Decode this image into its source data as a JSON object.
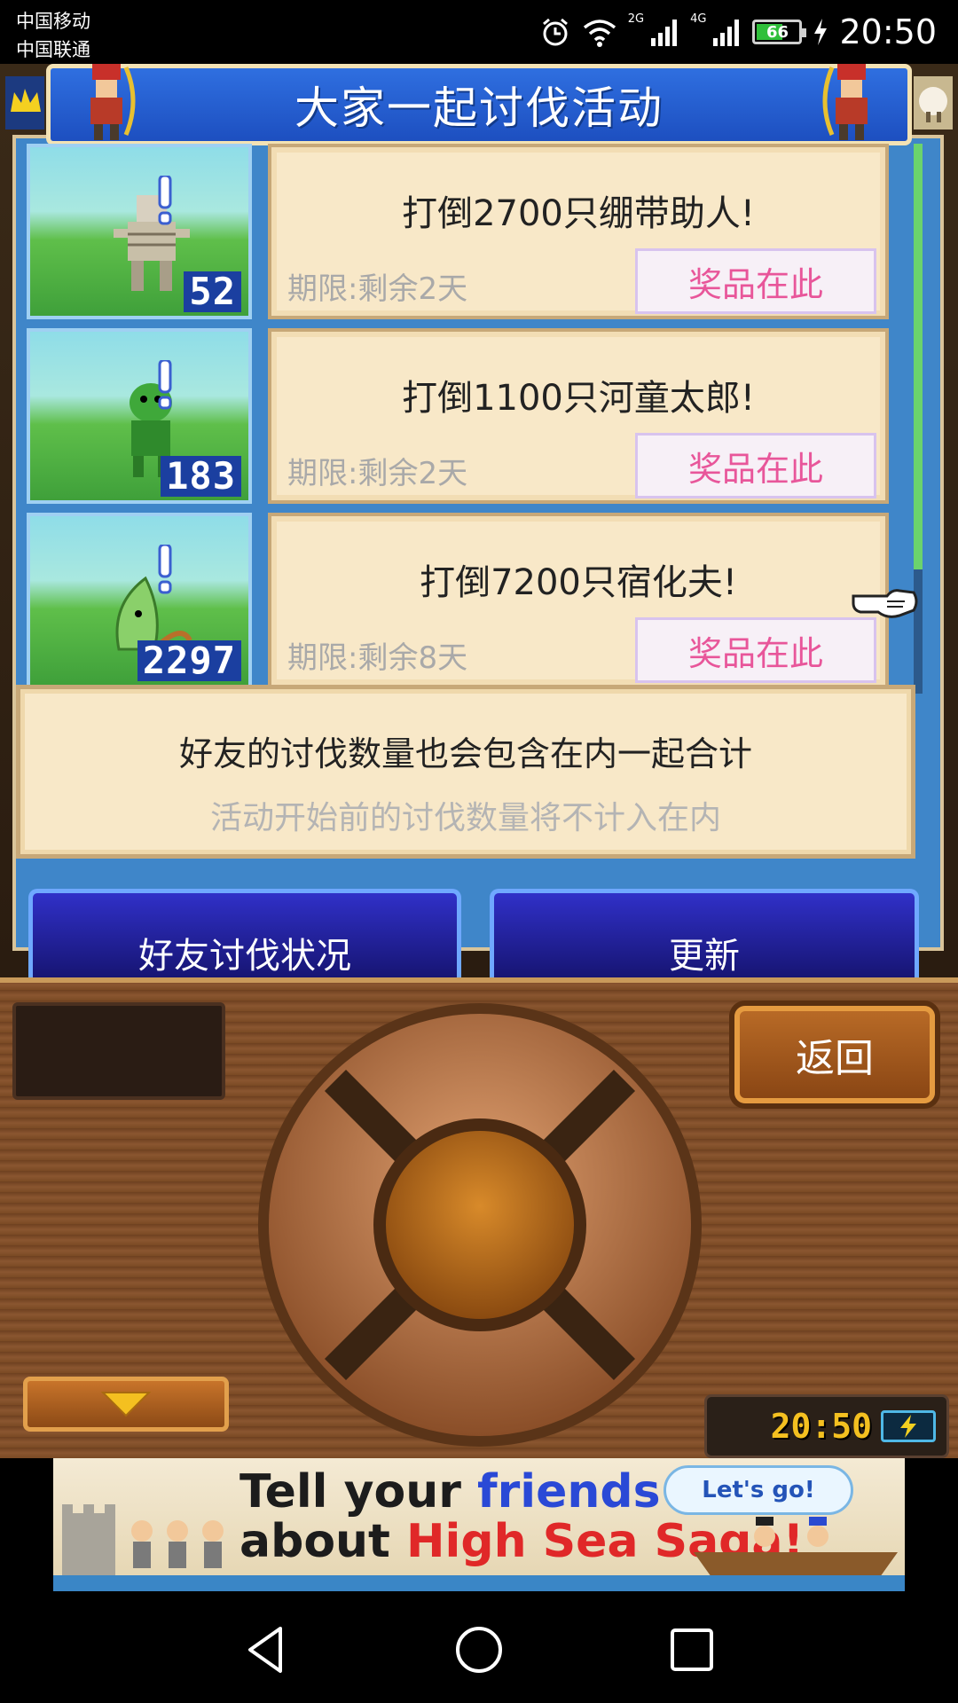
{
  "status_bar": {
    "carrier_1": "中国移动",
    "carrier_2": "中国联通",
    "net_1": "2G",
    "net_2": "4G",
    "battery_level": "66",
    "battery_fraction": 0.66,
    "time": "20:50"
  },
  "title": "大家一起讨伐活动",
  "events": [
    {
      "count": "52",
      "title": "打倒2700只绷带助人!",
      "deadline": "期限:剩余2天",
      "prize_label": "奖品在此",
      "monster": "bandage-monster"
    },
    {
      "count": "183",
      "title": "打倒1100只河童太郎!",
      "deadline": "期限:剩余2天",
      "prize_label": "奖品在此",
      "monster": "kappa-monster"
    },
    {
      "count": "2297",
      "title": "打倒7200只宿化夫!",
      "deadline": "期限:剩余8天",
      "prize_label": "奖品在此",
      "monster": "leaf-monster"
    }
  ],
  "info": {
    "main": "好友的讨伐数量也会包含在内一起合计",
    "sub": "活动开始前的讨伐数量将不计入在内"
  },
  "buttons": {
    "friends_status": "好友讨伐状况",
    "refresh": "更新",
    "back": "返回"
  },
  "controller": {
    "clock": "20:50"
  },
  "ad": {
    "line1_a": "Tell your ",
    "line1_b": "friends",
    "line2_a": "about ",
    "line2_b": "High Sea Saga!",
    "cta": "Let's go!"
  },
  "colors": {
    "panel_blue": "#3f86c9",
    "card_bg": "#f8e8c8",
    "prize_text": "#e8569a",
    "button_blue": "#1f1c9a"
  },
  "icons": [
    "alarm-icon",
    "wifi-icon",
    "signal-icon",
    "battery-icon",
    "charging-icon",
    "pointer-hand-icon",
    "down-arrow-icon",
    "nav-back-icon",
    "nav-home-icon",
    "nav-recent-icon"
  ]
}
